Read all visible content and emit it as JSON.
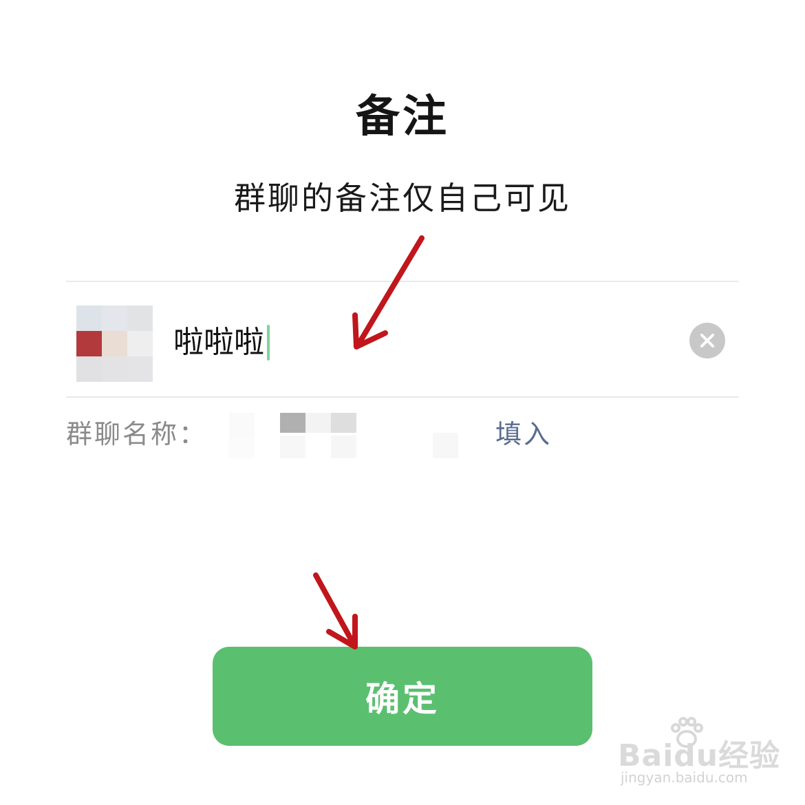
{
  "dialog": {
    "title": "备注",
    "subtitle": "群聊的备注仅自己可见"
  },
  "remark_field": {
    "value": "啦啦啦",
    "clear_icon": "clear-icon",
    "avatar_icon": "group-avatar"
  },
  "group_name_row": {
    "label": "群聊名称：",
    "fill_label": "填入"
  },
  "confirm_button": {
    "label": "确定"
  },
  "colors": {
    "confirm_green": "#5bbf70",
    "link_blue": "#5a6d91",
    "caret_green": "#7fd49a",
    "arrow_red": "#c0161c"
  },
  "watermark": {
    "logo": "Baidu经验",
    "url": "jingyan.baidu.com"
  }
}
